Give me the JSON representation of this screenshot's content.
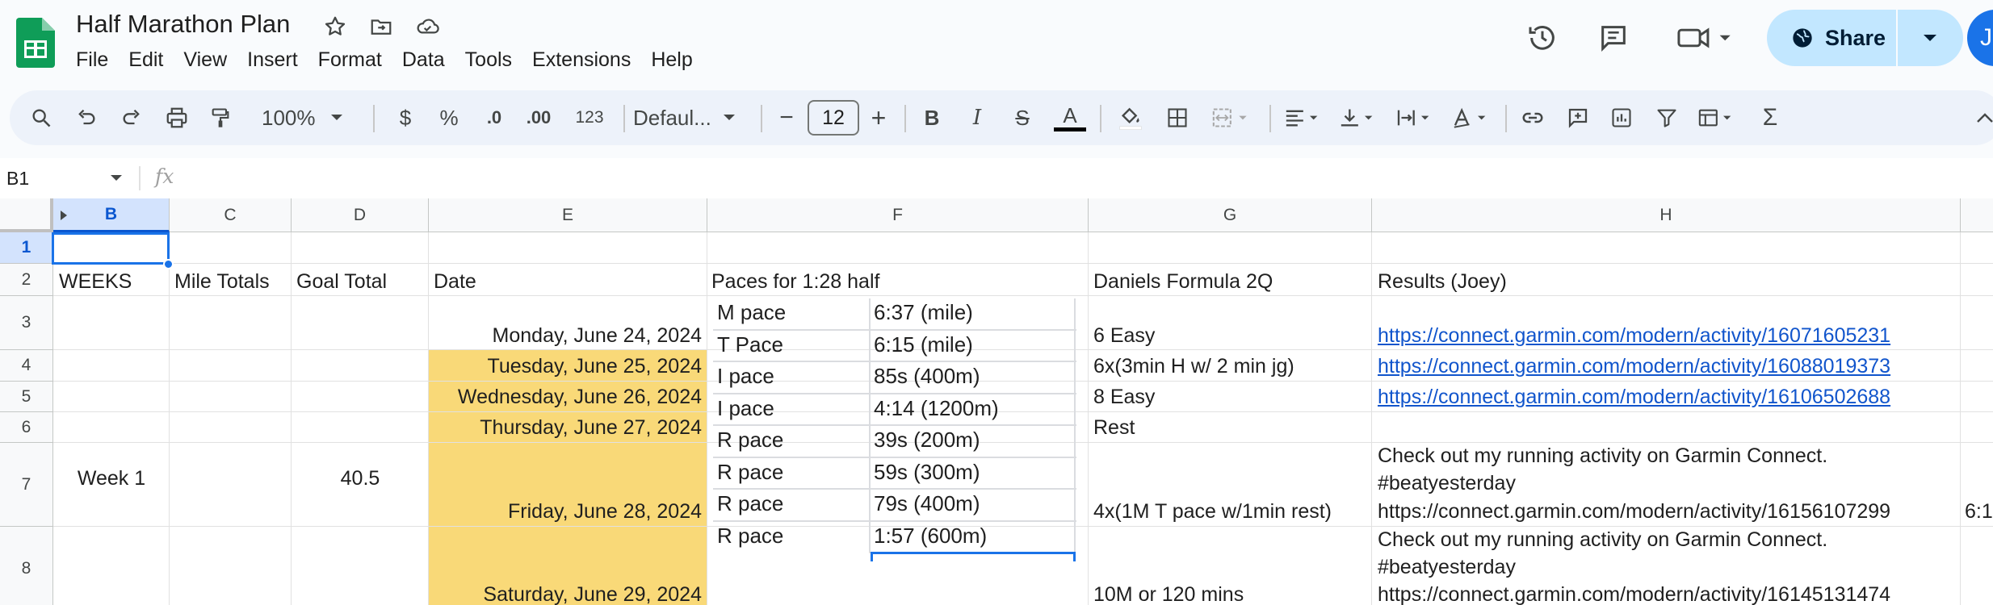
{
  "app": {
    "doc_title": "Half Marathon Plan",
    "menu": [
      "File",
      "Edit",
      "View",
      "Insert",
      "Format",
      "Data",
      "Tools",
      "Extensions",
      "Help"
    ],
    "share_label": "Share",
    "avatar_initial": "J",
    "brand_color": "#0f9d58",
    "accent_color": "#c2e7ff"
  },
  "toolbar": {
    "zoom": "100%",
    "currency": "$",
    "percent": "%",
    "dec_decrease": ".0",
    "dec_increase": ".00",
    "number_format": "123",
    "font": "Defaul...",
    "font_size": "12",
    "minus": "−",
    "plus": "+",
    "bold": "B",
    "italic": "I",
    "strike": "S",
    "text_color": "A",
    "sigma": "Σ"
  },
  "formula_bar": {
    "name_box": "B1",
    "fx": "fx"
  },
  "grid": {
    "columns": [
      "B",
      "C",
      "D",
      "E",
      "F",
      "G",
      "H"
    ],
    "selected_column": "B",
    "rows": [
      "1",
      "2",
      "3",
      "4",
      "5",
      "6",
      "7",
      "8"
    ],
    "selected_row": "1",
    "headers": {
      "B": "WEEKS",
      "C": "Mile Totals",
      "D": "Goal Total",
      "E": "Date",
      "F": "Paces for 1:28 half",
      "G": "Daniels Formula 2Q",
      "H": "Results (Joey)"
    },
    "week_label": "Week 1",
    "goal_total": "40.5",
    "dates": [
      "Monday, June 24, 2024",
      "Tuesday, June 25, 2024",
      "Wednesday, June 26, 2024",
      "Thursday, June 27, 2024",
      "Friday, June 28, 2024",
      "Saturday, June 29, 2024"
    ],
    "workouts": [
      "6 Easy",
      "6x(3min H w/ 2 min jg)",
      "8 Easy",
      "Rest",
      "4x(1M T pace w/1min rest)",
      "10M or 120 mins"
    ],
    "results": {
      "r3": "https://connect.garmin.com/modern/activity/16071605231",
      "r4": "https://connect.garmin.com/modern/activity/16088019373",
      "r5": "https://connect.garmin.com/modern/activity/16106502688",
      "r7_line1": "Check out my running activity on Garmin Connect.",
      "r7_line2": "#beatyesterday",
      "r7_line3": "https://connect.garmin.com/modern/activity/16156107299",
      "r8_line1": "Check out my running activity on Garmin Connect.",
      "r8_line2": "#beatyesterday",
      "r8_line3": "https://connect.garmin.com/modern/activity/16145131474"
    },
    "overflow_i7": "6:1",
    "paces": [
      {
        "label": "M pace",
        "value": "6:37 (mile)"
      },
      {
        "label": "T Pace",
        "value": "6:15 (mile)"
      },
      {
        "label": "I pace",
        "value": "85s (400m)"
      },
      {
        "label": "I pace",
        "value": "4:14 (1200m)"
      },
      {
        "label": "R pace",
        "value": "39s (200m)"
      },
      {
        "label": "R pace",
        "value": "59s (300m)"
      },
      {
        "label": "R pace",
        "value": "79s (400m)"
      },
      {
        "label": "R pace",
        "value": "1:57 (600m)"
      }
    ]
  }
}
